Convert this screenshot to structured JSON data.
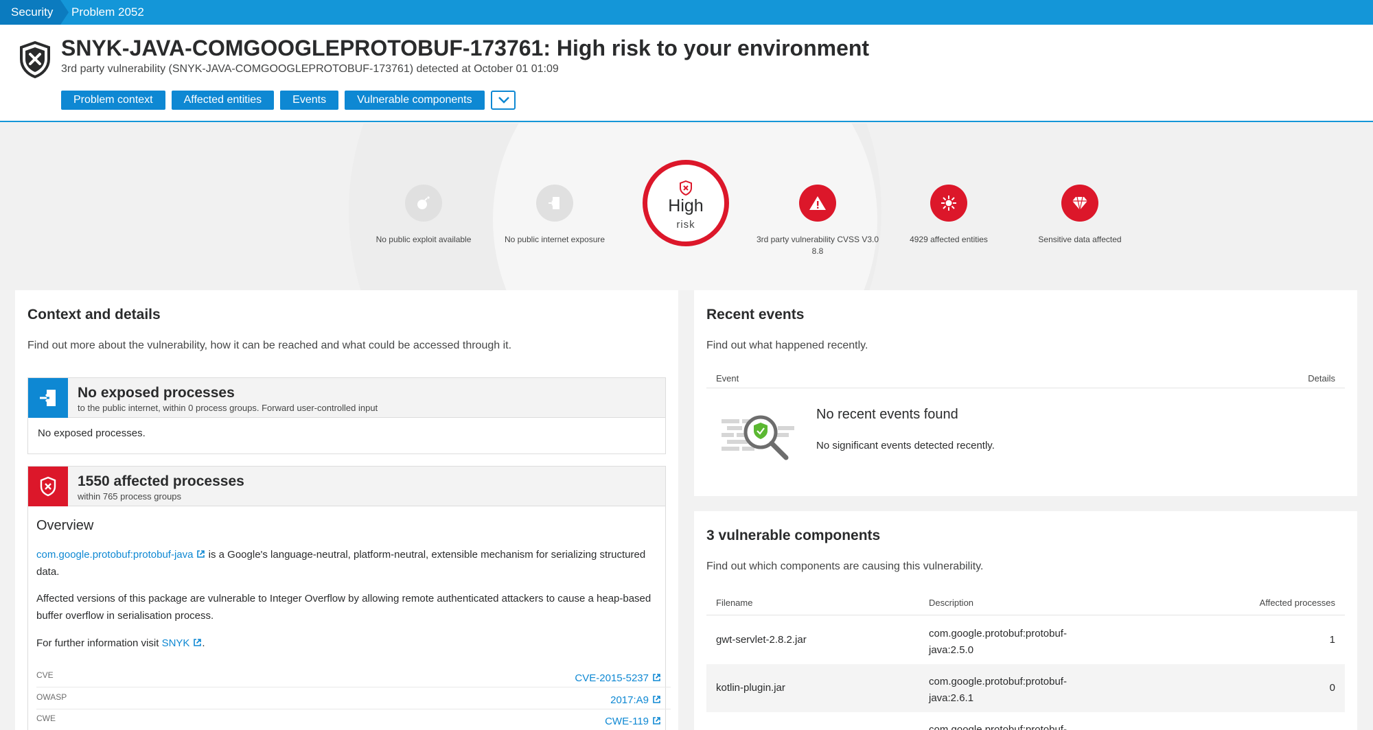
{
  "breadcrumb": {
    "root": "Security",
    "current": "Problem 2052"
  },
  "header": {
    "title": "SNYK-JAVA-COMGOOGLEPROTOBUF-173761: High risk to your environment",
    "subtitle": "3rd party vulnerability (SNYK-JAVA-COMGOOGLEPROTOBUF-173761) detected at October 01 01:09",
    "tabs": [
      "Problem context",
      "Affected entities",
      "Events",
      "Vulnerable components"
    ],
    "more_icon": "chevron-down-icon"
  },
  "overview": {
    "risk_level": "High",
    "risk_word": "risk",
    "metrics": [
      {
        "label": "No public exploit available",
        "icon": "bomb-icon",
        "state": "inactive"
      },
      {
        "label": "No public internet exposure",
        "icon": "door-exit-icon",
        "state": "inactive"
      },
      {
        "label": "3rd party vulnerability CVSS V3.0",
        "value": "8.8",
        "icon": "warning-icon",
        "state": "active"
      },
      {
        "label": "4929 affected entities",
        "icon": "affected-entities-icon",
        "state": "active"
      },
      {
        "label": "Sensitive data affected",
        "icon": "diamond-icon",
        "state": "active"
      }
    ],
    "colors": {
      "risk": "#dc172a",
      "accent": "#0e88d3",
      "inactive": "#e0e0e0"
    }
  },
  "context": {
    "title": "Context and details",
    "description": "Find out more about the vulnerability, how it can be reached and what could be accessed through it.",
    "exposed": {
      "heading": "No exposed processes",
      "sub": "to the public internet, within 0 process groups. Forward user-controlled input",
      "body": "No exposed processes."
    },
    "affected": {
      "heading": "1550 affected processes",
      "sub": "within 765 process groups"
    },
    "overview_title": "Overview",
    "package_link": "com.google.protobuf:protobuf-java",
    "package_text": " is a Google's language-neutral, platform-neutral, extensible mechanism for serializing structured data.",
    "affected_text": "Affected versions of this package are vulnerable to Integer Overflow by allowing remote authenticated attackers to cause a heap-based buffer overflow in serialisation process.",
    "further_prefix": "For further information visit ",
    "further_link": "SNYK",
    "further_suffix": ".",
    "references": [
      {
        "key": "CVE",
        "value": "CVE-2015-5237"
      },
      {
        "key": "OWASP",
        "value": "2017:A9"
      },
      {
        "key": "CWE",
        "value": "CWE-119"
      }
    ]
  },
  "events": {
    "title": "Recent events",
    "description": "Find out what happened recently.",
    "col_event": "Event",
    "col_details": "Details",
    "empty_title": "No recent events found",
    "empty_desc": "No significant events detected recently."
  },
  "components": {
    "title": "3 vulnerable components",
    "description": "Find out which components are causing this vulnerability.",
    "columns": [
      "Filename",
      "Description",
      "Affected processes"
    ],
    "rows": [
      {
        "filename": "gwt-servlet-2.8.2.jar",
        "description": "com.google.protobuf:protobuf-java:2.5.0",
        "affected": "1"
      },
      {
        "filename": "kotlin-plugin.jar",
        "description": "com.google.protobuf:protobuf-java:2.6.1",
        "affected": "0"
      },
      {
        "filename": "",
        "description": "com.google.protobuf:protobuf-",
        "affected": ""
      }
    ]
  }
}
